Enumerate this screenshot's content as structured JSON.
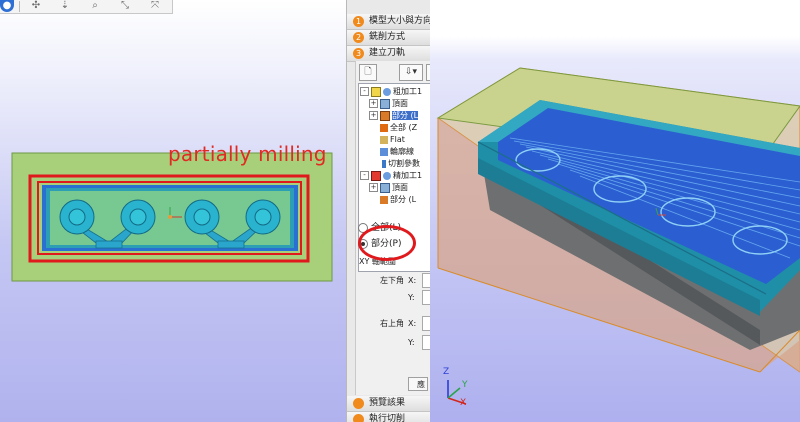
{
  "annotation": {
    "text": "partially milling",
    "color": "#e02a23"
  },
  "toolbar": {
    "buttons": [
      {
        "icon": "select-icon"
      },
      {
        "icon": "pan-icon"
      },
      {
        "icon": "rotate-icon"
      },
      {
        "icon": "zoom-icon"
      },
      {
        "icon": "zoom-fit-icon"
      },
      {
        "icon": "zoom-box-icon"
      }
    ]
  },
  "steps": [
    {
      "num": "1",
      "label": "模型大小與方向"
    },
    {
      "num": "2",
      "label": "銑削方式"
    },
    {
      "num": "3",
      "label": "建立刀軌"
    }
  ],
  "bottom_steps": [
    {
      "label": "預覽該果"
    },
    {
      "label": "執行切削"
    }
  ],
  "tree": [
    {
      "label": "粗加工1",
      "expander": "-"
    },
    {
      "label": "頂面",
      "expander": "+"
    },
    {
      "label": "部分 (L",
      "expander": "+",
      "selected": true
    },
    {
      "label": "全部 (Z"
    },
    {
      "label": "Flat"
    },
    {
      "label": "輪廓線"
    },
    {
      "label": "切割參數"
    },
    {
      "label": "精加工1",
      "expander": "-"
    },
    {
      "label": "頂面",
      "expander": "+"
    },
    {
      "label": "部分 (L"
    }
  ],
  "region": {
    "option_all": "全部(L)",
    "option_partial": "部分(P)",
    "selected": "option_partial",
    "group_label": "XY 軸範圍",
    "lower_left": "左下角",
    "upper_right": "右上角",
    "x": "X:",
    "y": "Y:",
    "apply_label": "應"
  },
  "colors": {
    "stock": "#a5d47c",
    "tool_path": "#2b72e8",
    "annotation_border": "#e0191d",
    "step_badge": "#f08a1c"
  },
  "axis": {
    "x": "X",
    "y": "Y",
    "z": "Z"
  }
}
